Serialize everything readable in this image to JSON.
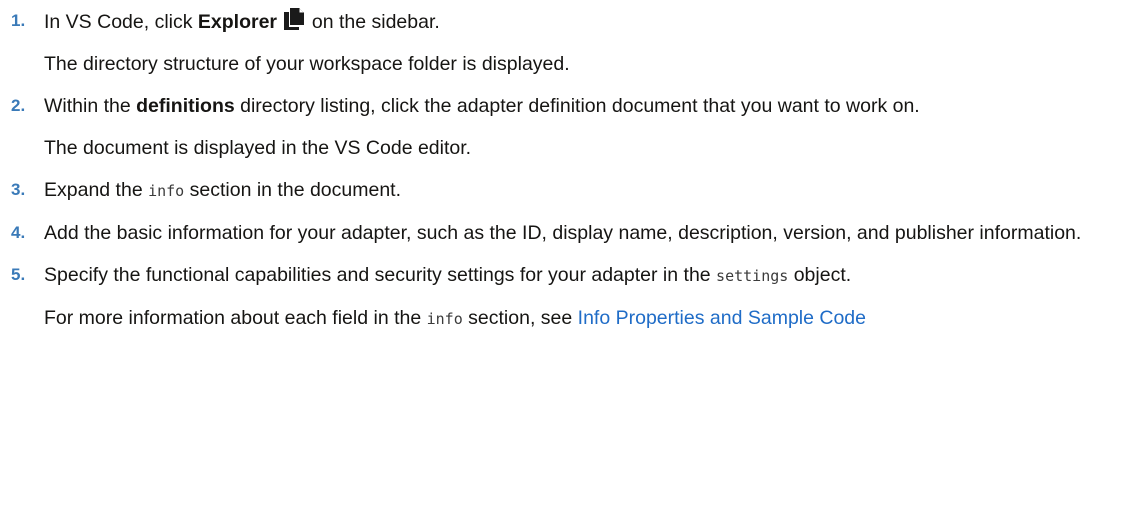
{
  "steps": [
    {
      "number": "1.",
      "text_before": "In VS Code, click ",
      "bold": "Explorer",
      "icon": "explorer-files-icon",
      "text_after": " on the sidebar.",
      "result": "The directory structure of your workspace folder is displayed."
    },
    {
      "number": "2.",
      "text_before": "Within the ",
      "bold": "definitions",
      "text_after": " directory listing, click the adapter definition document that you want to work on.",
      "result": "The document is displayed in the VS Code editor."
    },
    {
      "number": "3.",
      "text_before": "Expand the ",
      "code": "info",
      "text_after": " section in the document."
    },
    {
      "number": "4.",
      "text": "Add the basic information for your adapter, such as the ID, display name, description, version, and publisher information."
    },
    {
      "number": "5.",
      "text_before": "Specify the functional capabilities and security settings for your adapter in the ",
      "code": "settings",
      "text_after": " object.",
      "result_before": "For more information about each field in the ",
      "result_code": "info",
      "result_middle": " section, see ",
      "result_link": "Info Properties and Sample Code"
    }
  ],
  "colors": {
    "step_number": "#3a7ab8",
    "link": "#1f6cc7",
    "text": "#161513"
  }
}
